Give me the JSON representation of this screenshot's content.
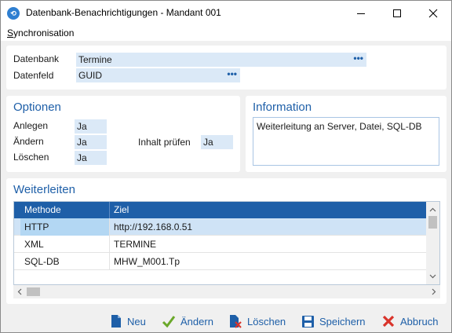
{
  "window": {
    "title": "Datenbank-Benachrichtigungen - Mandant 001",
    "app_icon": "app-logo-icon"
  },
  "menu": {
    "items": [
      {
        "label": "Synchronisation",
        "mnemonic": "S"
      }
    ]
  },
  "database": {
    "datenbank_label": "Datenbank",
    "datenbank_value": "Termine",
    "datenfeld_label": "Datenfeld",
    "datenfeld_value": "GUID",
    "ellipsis": "•••"
  },
  "optionen": {
    "title": "Optionen",
    "anlegen_label": "Anlegen",
    "anlegen_value": "Ja",
    "aendern_label": "Ändern",
    "aendern_value": "Ja",
    "loeschen_label": "Löschen",
    "loeschen_value": "Ja",
    "inhalt_label": "Inhalt prüfen",
    "inhalt_value": "Ja"
  },
  "information": {
    "title": "Information",
    "text": "Weiterleitung an Server, Datei, SQL-DB"
  },
  "weiterleiten": {
    "title": "Weiterleiten",
    "columns": [
      "Methode",
      "Ziel"
    ],
    "rows": [
      {
        "methode": "HTTP",
        "ziel": "http://192.168.0.51",
        "selected": true
      },
      {
        "methode": "XML",
        "ziel": "TERMINE",
        "selected": false
      },
      {
        "methode": "SQL-DB",
        "ziel": "MHW_M001.Tp",
        "selected": false
      }
    ]
  },
  "actions": {
    "neu": "Neu",
    "aendern": "Ändern",
    "loeschen": "Löschen",
    "speichern": "Speichern",
    "abbruch": "Abbruch"
  },
  "colors": {
    "accent": "#1e5fa8",
    "field_bg": "#dbe9f7",
    "selected_row": "#cfe3f6",
    "selected_cell": "#b3d7f3",
    "check_green": "#6aa82a",
    "cancel_red": "#d9342b"
  }
}
